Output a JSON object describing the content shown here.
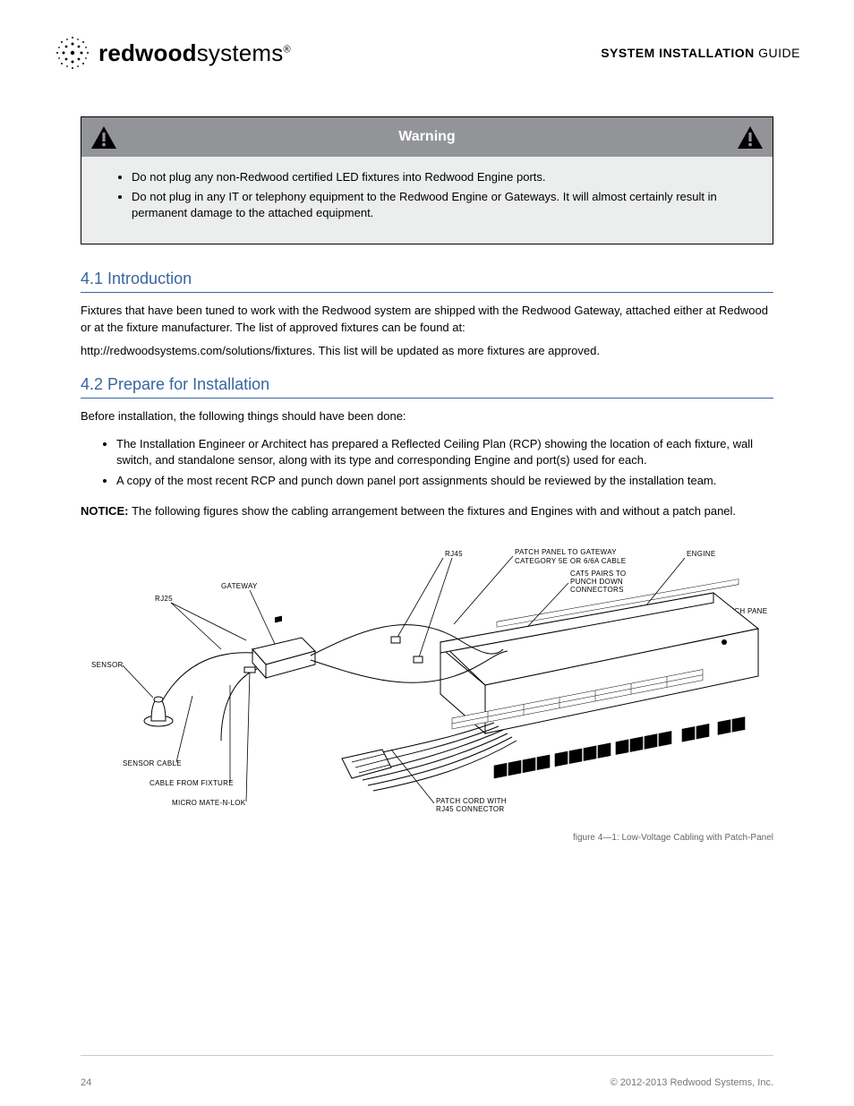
{
  "header": {
    "logo_bold": "redwood",
    "logo_light": "systems",
    "logo_reg": "®",
    "title_bold": "SYSTEM INSTALLATION",
    "title_light": " GUIDE"
  },
  "warning": {
    "title": "Warning",
    "items": [
      "Do not plug any non-Redwood certified LED fixtures into Redwood Engine ports.",
      "Do not plug in any IT or telephony equipment to the Redwood Engine or Gateways. It will almost certainly result in permanent damage to the attached equipment."
    ]
  },
  "section4_1": {
    "heading": "4.1 Introduction",
    "p1": "Fixtures that have been tuned to work with the Redwood system are shipped with the Redwood Gateway, attached either at Redwood or at the fixture manufacturer. The list of approved fixtures can be found at:",
    "p2_url": "http://redwoodsystems.com/solutions/fixtures",
    "p2_rest": ". This list will be updated as more fixtures are approved."
  },
  "section4_2": {
    "heading": "4.2 Prepare for Installation",
    "p1": "Before installation, the following things should have been done:",
    "bullets": [
      "The Installation Engineer or Architect has prepared a Reflected Ceiling Plan (RCP) showing the location of each fixture, wall switch, and standalone sensor, along with its type and corresponding Engine and port(s) used for each.",
      "A copy of the most recent RCP and punch down panel port assignments should be reviewed by the installation team."
    ],
    "notice_label": "NOTICE: ",
    "notice_text": "The following figures show the cabling arrangement between the fixtures and Engines with and without a patch panel."
  },
  "diagram_labels": {
    "rj25": "RJ25",
    "gateway": "GATEWAY",
    "rj45": "RJ45",
    "patch_to_gateway_1": "PATCH PANEL TO GATEWAY",
    "patch_to_gateway_2": "CATEGORY 5E OR 6/6A CABLE",
    "cat5_pairs_1": "CAT5 PAIRS TO",
    "cat5_pairs_2": "PUNCH DOWN",
    "cat5_pairs_3": "CONNECTORS",
    "engine": "ENGINE",
    "patch_panel": "PATCH PANEL",
    "sensor": "SENSOR",
    "sensor_cable": "SENSOR CABLE",
    "cable_from_fixture": "CABLE FROM FIXTURE",
    "micro_mate": "MICRO MATE-N-LOK",
    "patch_cord_1": "PATCH CORD WITH",
    "patch_cord_2": "RJ45 CONNECTOR"
  },
  "figure": {
    "caption": "figure 4—1: Low-Voltage Cabling with Patch-Panel"
  },
  "footer": {
    "page": "24",
    "copyright": "© 2012-2013 Redwood Systems, Inc."
  }
}
